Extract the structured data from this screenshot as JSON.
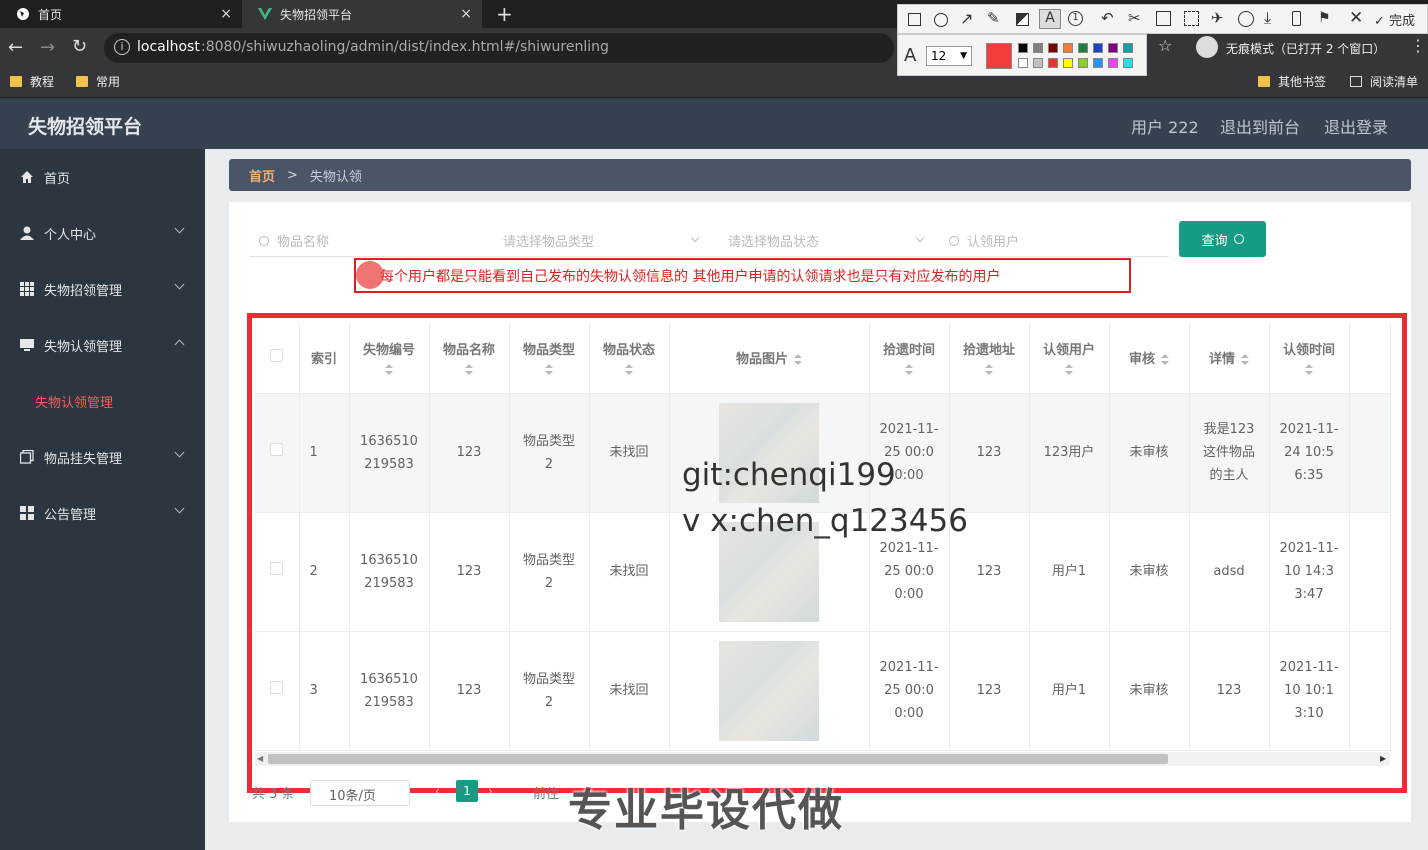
{
  "browser": {
    "tabs": [
      {
        "label": "首页"
      },
      {
        "label": "失物招领平台"
      }
    ],
    "url_host": "localhost",
    "url_rest": ":8080/shiwuzhaoling/admin/dist/index.html#/shiwurenling",
    "bookmarks": [
      "教程",
      "常用"
    ],
    "bookmarks_right": [
      "其他书签",
      "阅读清单"
    ],
    "incognito": "无痕模式（已打开 2 个窗口）",
    "annot_font_size": "12",
    "annot_done": "完成"
  },
  "header": {
    "title": "失物招领平台",
    "user": "用户 222",
    "to_front": "退出到前台",
    "logout": "退出登录"
  },
  "sidebar": {
    "items": [
      {
        "label": "首页"
      },
      {
        "label": "个人中心"
      },
      {
        "label": "失物招领管理"
      },
      {
        "label": "失物认领管理"
      },
      {
        "label": "失物认领管理"
      },
      {
        "label": "物品挂失管理"
      },
      {
        "label": "公告管理"
      }
    ]
  },
  "breadcrumb": {
    "home": "首页",
    "sep": ">",
    "current": "失物认领"
  },
  "search": {
    "name_placeholder": "物品名称",
    "type_placeholder": "请选择物品类型",
    "status_placeholder": "请选择物品状态",
    "user_placeholder": "认领用户",
    "query_label": "查询"
  },
  "notice": "每个用户都是只能看到自己发布的失物认领信息的  其他用户申请的认领请求也是只有对应发布的用户",
  "table": {
    "headers": [
      "索引",
      "失物编号",
      "物品名称",
      "物品类型",
      "物品状态",
      "物品图片",
      "拾遗时间",
      "拾遗地址",
      "认领用户",
      "审核",
      "详情",
      "认领时间"
    ],
    "rows": [
      {
        "idx": "1",
        "no": "1636510219583",
        "name": "123",
        "type": "物品类型2",
        "status": "未找回",
        "time": "2021-11-25 00:00:00",
        "addr": "123",
        "user": "123用户",
        "audit": "未审核",
        "detail": "我是123这件物品的主人",
        "claim": "2021-11-24 10:56:35"
      },
      {
        "idx": "2",
        "no": "1636510219583",
        "name": "123",
        "type": "物品类型2",
        "status": "未找回",
        "time": "2021-11-25 00:00:00",
        "addr": "123",
        "user": "用户1",
        "audit": "未审核",
        "detail": "adsd",
        "claim": "2021-11-10 14:33:47"
      },
      {
        "idx": "3",
        "no": "1636510219583",
        "name": "123",
        "type": "物品类型2",
        "status": "未找回",
        "time": "2021-11-25 00:00:00",
        "addr": "123",
        "user": "用户1",
        "audit": "未审核",
        "detail": "123",
        "claim": "2021-11-10 10:13:10"
      }
    ]
  },
  "pagination": {
    "total": "共 3 条",
    "page_size": "10条/页",
    "current": "1",
    "goto": "前往"
  },
  "watermarks": {
    "git": "git:chenqi199",
    "vx": "v x:chen_q123456",
    "ad": "专业毕设代做"
  },
  "colors": {
    "accent": "#169c84",
    "danger": "#e02020",
    "active_menu": "#ff5a5a"
  }
}
